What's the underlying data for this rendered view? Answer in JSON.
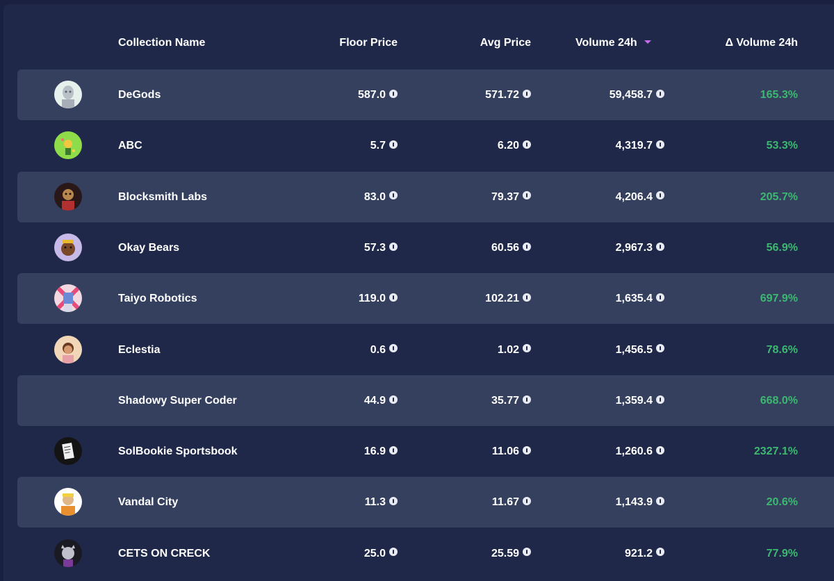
{
  "header": {
    "collection_name": "Collection Name",
    "floor_price": "Floor Price",
    "avg_price": "Avg Price",
    "volume_24h": "Volume 24h",
    "delta_volume_24h": "Δ Volume 24h",
    "sort_indicator_color": "#c86af0"
  },
  "colors": {
    "background": "#1a2140",
    "row_alt": "#35405f",
    "positive": "#3cb870"
  },
  "rows": [
    {
      "name": "DeGods",
      "floor": "587.0",
      "avg": "571.72",
      "vol": "59,458.7",
      "dvol": "165.3%",
      "avatar": "degods-avatar"
    },
    {
      "name": "ABC",
      "floor": "5.7",
      "avg": "6.20",
      "vol": "4,319.7",
      "dvol": "53.3%",
      "avatar": "abc-avatar"
    },
    {
      "name": "Blocksmith Labs",
      "floor": "83.0",
      "avg": "79.37",
      "vol": "4,206.4",
      "dvol": "205.7%",
      "avatar": "blocksmith-avatar"
    },
    {
      "name": "Okay Bears",
      "floor": "57.3",
      "avg": "60.56",
      "vol": "2,967.3",
      "dvol": "56.9%",
      "avatar": "okay-bears-avatar"
    },
    {
      "name": "Taiyo Robotics",
      "floor": "119.0",
      "avg": "102.21",
      "vol": "1,635.4",
      "dvol": "697.9%",
      "avatar": "taiyo-avatar"
    },
    {
      "name": "Eclestia",
      "floor": "0.6",
      "avg": "1.02",
      "vol": "1,456.5",
      "dvol": "78.6%",
      "avatar": "eclestia-avatar"
    },
    {
      "name": "Shadowy Super Coder",
      "floor": "44.9",
      "avg": "35.77",
      "vol": "1,359.4",
      "dvol": "668.0%",
      "avatar": ""
    },
    {
      "name": "SolBookie Sportsbook",
      "floor": "16.9",
      "avg": "11.06",
      "vol": "1,260.6",
      "dvol": "2327.1%",
      "avatar": "solbookie-avatar"
    },
    {
      "name": "Vandal City",
      "floor": "11.3",
      "avg": "11.67",
      "vol": "1,143.9",
      "dvol": "20.6%",
      "avatar": "vandal-avatar"
    },
    {
      "name": "CETS ON CRECK",
      "floor": "25.0",
      "avg": "25.59",
      "vol": "921.2",
      "dvol": "77.9%",
      "avatar": "cets-avatar"
    }
  ]
}
